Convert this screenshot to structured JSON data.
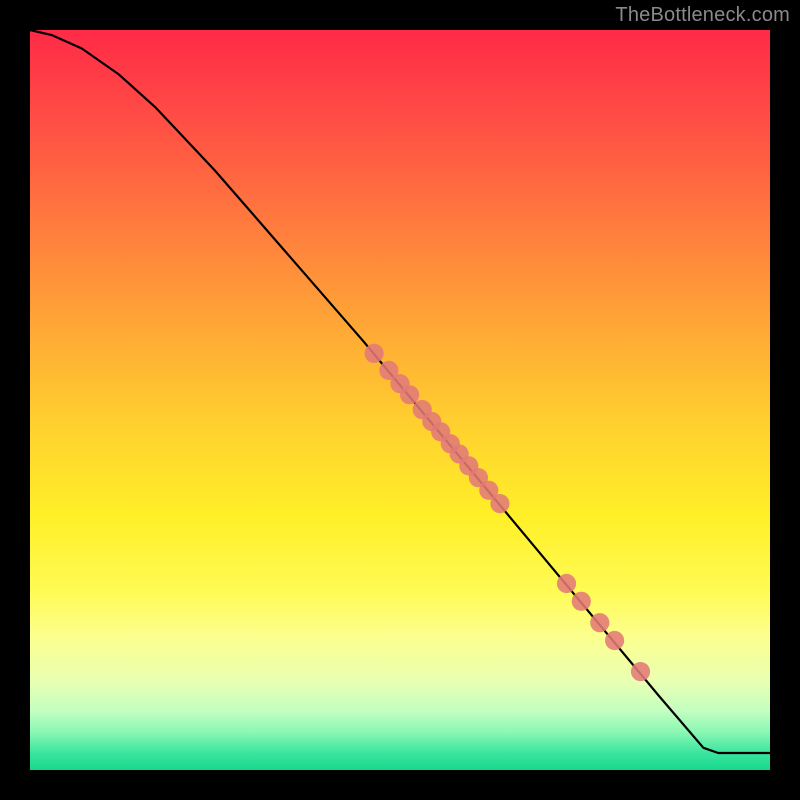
{
  "watermark": "TheBottleneck.com",
  "colors": {
    "marker_fill": "#e27a77",
    "curve_stroke": "#000000",
    "background": "#000000"
  },
  "chart_data": {
    "type": "line",
    "title": "",
    "xlabel": "",
    "ylabel": "",
    "xlim": [
      0,
      100
    ],
    "ylim": [
      0,
      100
    ],
    "grid": false,
    "legend": false,
    "curve": [
      {
        "x": 0,
        "y": 100
      },
      {
        "x": 3,
        "y": 99.3
      },
      {
        "x": 7,
        "y": 97.5
      },
      {
        "x": 12,
        "y": 94.0
      },
      {
        "x": 17,
        "y": 89.5
      },
      {
        "x": 25,
        "y": 81.0
      },
      {
        "x": 35,
        "y": 69.5
      },
      {
        "x": 45,
        "y": 58.0
      },
      {
        "x": 55,
        "y": 46.0
      },
      {
        "x": 65,
        "y": 34.0
      },
      {
        "x": 75,
        "y": 22.0
      },
      {
        "x": 85,
        "y": 10.0
      },
      {
        "x": 91,
        "y": 3.0
      },
      {
        "x": 93,
        "y": 2.3
      },
      {
        "x": 100,
        "y": 2.3
      }
    ],
    "markers_radius_domain_units": 1.3,
    "markers": [
      {
        "x": 46.5,
        "y": 56.3
      },
      {
        "x": 48.5,
        "y": 54.0
      },
      {
        "x": 50.0,
        "y": 52.2
      },
      {
        "x": 51.3,
        "y": 50.7
      },
      {
        "x": 53.0,
        "y": 48.7
      },
      {
        "x": 54.3,
        "y": 47.1
      },
      {
        "x": 55.5,
        "y": 45.7
      },
      {
        "x": 56.8,
        "y": 44.1
      },
      {
        "x": 58.0,
        "y": 42.7
      },
      {
        "x": 59.3,
        "y": 41.1
      },
      {
        "x": 60.6,
        "y": 39.5
      },
      {
        "x": 62.0,
        "y": 37.8
      },
      {
        "x": 63.5,
        "y": 36.0
      },
      {
        "x": 72.5,
        "y": 25.2
      },
      {
        "x": 74.5,
        "y": 22.8
      },
      {
        "x": 77.0,
        "y": 19.9
      },
      {
        "x": 79.0,
        "y": 17.5
      },
      {
        "x": 82.5,
        "y": 13.3
      }
    ]
  }
}
